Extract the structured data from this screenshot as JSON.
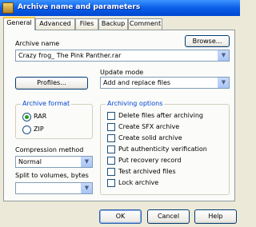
{
  "window": {
    "title": "Archive name and parameters",
    "icon": "winrar-icon"
  },
  "tabs": [
    {
      "label": "General",
      "active": true
    },
    {
      "label": "Advanced",
      "active": false
    },
    {
      "label": "Files",
      "active": false
    },
    {
      "label": "Backup",
      "active": false
    },
    {
      "label": "Comment",
      "active": false
    }
  ],
  "general": {
    "archive_name_label": "Archive name",
    "archive_name_value": "Crazy frog_ The Pink Panther.rar",
    "browse_label": "Browse...",
    "profiles_label": "Profiles...",
    "update_mode_label": "Update mode",
    "update_mode_value": "Add and replace files",
    "archive_format": {
      "title": "Archive format",
      "options": [
        {
          "label": "RAR",
          "selected": true
        },
        {
          "label": "ZIP",
          "selected": false
        }
      ]
    },
    "compression_label": "Compression method",
    "compression_value": "Normal",
    "split_label": "Split to volumes, bytes",
    "split_value": "",
    "archiving_options": {
      "title": "Archiving options",
      "items": [
        {
          "label": "Delete files after archiving",
          "checked": false
        },
        {
          "label": "Create SFX archive",
          "checked": false
        },
        {
          "label": "Create solid archive",
          "checked": false
        },
        {
          "label": "Put authenticity verification",
          "checked": false
        },
        {
          "label": "Put recovery record",
          "checked": false
        },
        {
          "label": "Test archived files",
          "checked": false
        },
        {
          "label": "Lock archive",
          "checked": false
        }
      ]
    }
  },
  "buttons": {
    "ok": "OK",
    "cancel": "Cancel",
    "help": "Help"
  },
  "colors": {
    "titlebar": "#0a5ee8",
    "group_title": "#0046d5",
    "dialog_bg": "#ece9d8"
  }
}
